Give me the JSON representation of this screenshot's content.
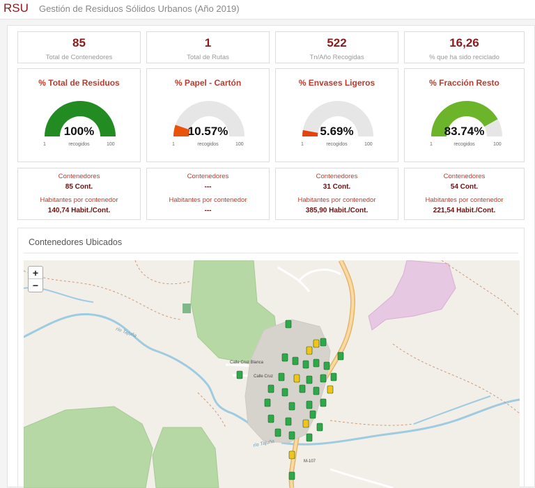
{
  "header": {
    "brand": "RSU",
    "subtitle": "Gestión de Residuos Sólidos Urbanos (Año 2019)"
  },
  "stats": [
    {
      "value": "85",
      "label": "Total de Contenedores"
    },
    {
      "value": "1",
      "label": "Total de Rutas"
    },
    {
      "value": "522",
      "label": "Tn/Año  Recogidas"
    },
    {
      "value": "16,26",
      "label": "% que ha sido reciclado"
    }
  ],
  "gauges": [
    {
      "title": "% Total de Residuos",
      "value": 100,
      "display": "100%",
      "min": "1",
      "max": "100",
      "unit": "recogidos",
      "color": "#228b22"
    },
    {
      "title": "% Papel - Cartón",
      "value": 10.57,
      "display": "10.57%",
      "min": "1",
      "max": "100",
      "unit": "recogidos",
      "color": "#e8540c"
    },
    {
      "title": "% Envases Ligeros",
      "value": 5.69,
      "display": "5.69%",
      "min": "1",
      "max": "100",
      "unit": "recogidos",
      "color": "#e8420c"
    },
    {
      "title": "% Fracción Resto",
      "value": 83.74,
      "display": "83.74%",
      "min": "1",
      "max": "100",
      "unit": "recogidos",
      "color": "#6cb52a"
    }
  ],
  "info_cards": [
    {
      "containers_label": "Contenedores",
      "containers_value": "85 Cont.",
      "hab_label": "Habitantes por contenedor",
      "hab_value": "140,74 Habit./Cont."
    },
    {
      "containers_label": "Contenedores",
      "containers_value": "---",
      "hab_label": "Habitantes por contenedor",
      "hab_value": "---"
    },
    {
      "containers_label": "Contenedores",
      "containers_value": "31 Cont.",
      "hab_label": "Habitantes por contenedor",
      "hab_value": "385,90 Habit./Cont."
    },
    {
      "containers_label": "Contenedores",
      "containers_value": "54 Cont.",
      "hab_label": "Habitantes por contenedor",
      "hab_value": "221,54 Habit./Cont."
    }
  ],
  "map": {
    "title": "Contenedores Ubicados",
    "zoom_in": "+",
    "zoom_out": "−",
    "labels": {
      "river1": "río Tajuña",
      "river2": "río Tajuña",
      "street1": "Calle Cruz Blanca",
      "street2": "Calle Cruz",
      "road": "M-107"
    }
  }
}
